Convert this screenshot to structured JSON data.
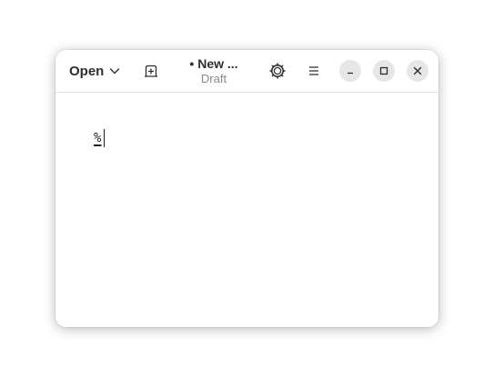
{
  "header": {
    "open_label": "Open",
    "title": "• New ...",
    "subtitle": "Draft"
  },
  "icons": {
    "open_menu": "chevron-down-icon",
    "new_tab": "new-tab-icon",
    "theme": "theme-icon",
    "menu": "hamburger-menu-icon",
    "minimize": "minimize-icon",
    "maximize": "maximize-icon",
    "close": "close-icon"
  },
  "editor": {
    "content": "%"
  }
}
